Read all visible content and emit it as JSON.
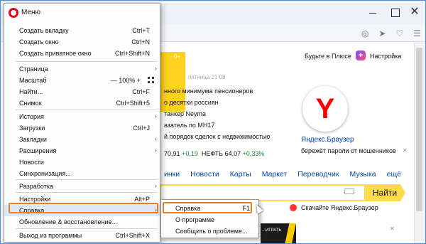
{
  "menu": {
    "title": "Меню",
    "items": [
      {
        "label": "Создать вкладку",
        "shortcut": "Ctrl+T"
      },
      {
        "label": "Создать окно",
        "shortcut": "Ctrl+N"
      },
      {
        "label": "Создать приватное окно",
        "shortcut": "Ctrl+Shift+N"
      },
      {
        "label": "Страница"
      },
      {
        "label": "Масштаб",
        "zoom": "— 100% +"
      },
      {
        "label": "Найти...",
        "shortcut": "Ctrl+F"
      },
      {
        "label": "Снимок",
        "shortcut": "Ctrl+Shift+5"
      },
      {
        "label": "История"
      },
      {
        "label": "Загрузки",
        "shortcut": "Ctrl+J"
      },
      {
        "label": "Закладки"
      },
      {
        "label": "Расширения"
      },
      {
        "label": "Новости"
      },
      {
        "label": "Синхронизация..."
      },
      {
        "label": "Разработка"
      },
      {
        "label": "Настройки",
        "shortcut": "Alt+P"
      },
      {
        "label": "Справка"
      },
      {
        "label": "Обновление & восстановление..."
      },
      {
        "label": "Выход из программы",
        "shortcut": "Ctrl+Shift+X"
      }
    ]
  },
  "submenu": {
    "items": [
      {
        "label": "Справка",
        "shortcut": "F1"
      },
      {
        "label": "О программе"
      },
      {
        "label": "Сообщить о проблеме..."
      }
    ]
  },
  "page": {
    "yellow_counter": "0+",
    "date": "пятница 21 08",
    "news": [
      "нного минимума пенсионеров",
      "о десятки россиян",
      "танкер Neyma",
      "азатель по МН17",
      "й порядок сделок с недвижимостью"
    ],
    "rates": {
      "usd_value": "70,91",
      "usd_change": "+0,19",
      "oil_label": "НЕФТЬ",
      "oil_value": "64,07",
      "oil_change": "+0,33%"
    },
    "services": [
      "инки",
      "Новости",
      "Карты",
      "Маркет",
      "Переводчик",
      "Музыка",
      "ещё"
    ],
    "plus_link": "Будьте в Плюсе",
    "settings_link": "Настройка",
    "brand": "Яндекс.Браузер",
    "slogan": "бережёт пароли от мошенников",
    "search_button": "Найти",
    "download_link": "Скачайте Яндекс.Браузер",
    "promo_text": "...ИГРАТЬ"
  },
  "colors": {
    "accent": "#ee7d21",
    "opera_red": "#e8001c",
    "yandex_yellow": "#ffdb4d"
  }
}
